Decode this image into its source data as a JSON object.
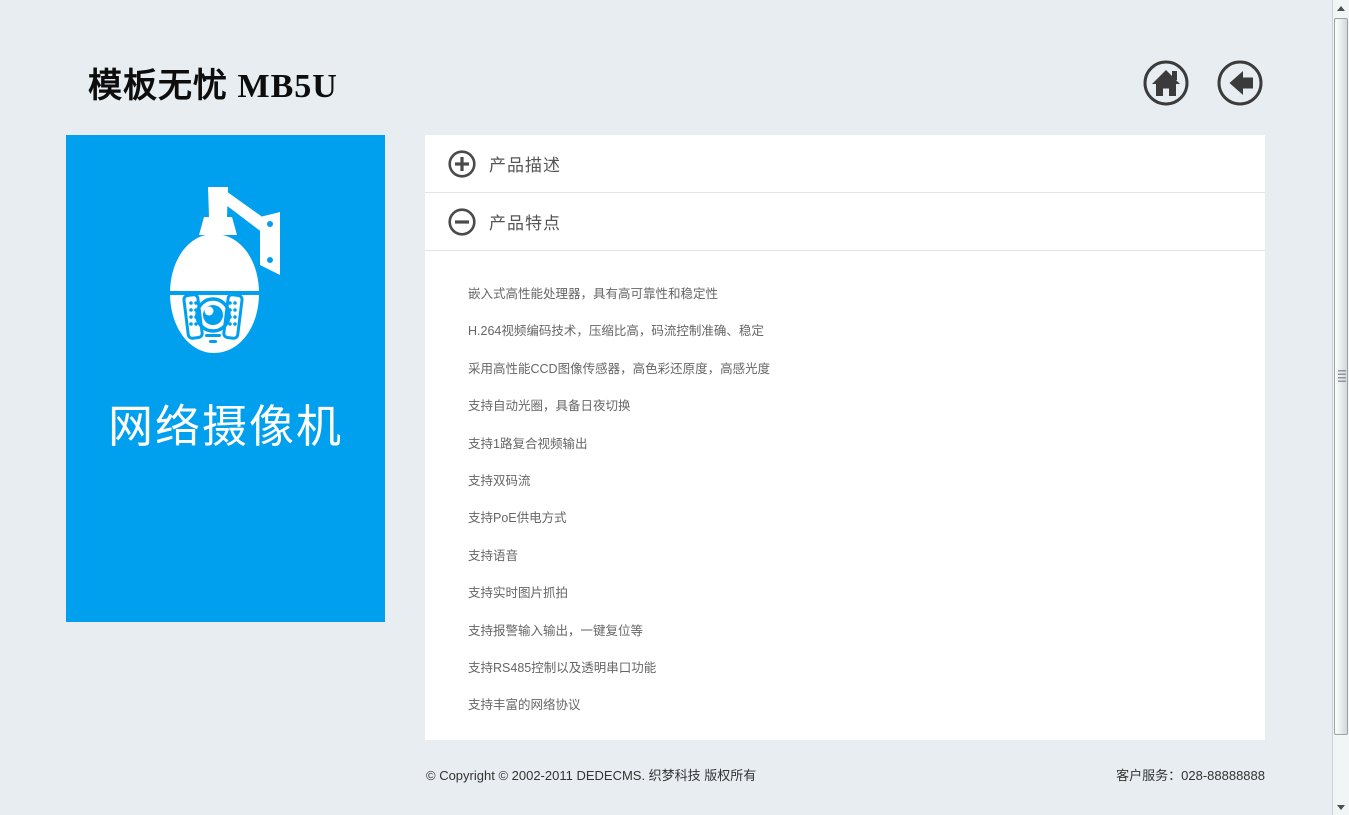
{
  "header": {
    "site_title": "模板无忧 MB5U"
  },
  "sidebar": {
    "product_name": "网络摄像机"
  },
  "accordion": {
    "sections": [
      {
        "label": "产品描述",
        "state": "collapsed"
      },
      {
        "label": "产品特点",
        "state": "expanded"
      }
    ]
  },
  "features": [
    "嵌入式高性能处理器，具有高可靠性和稳定性",
    "H.264视频编码技术，压缩比高，码流控制准确、稳定",
    "采用高性能CCD图像传感器，高色彩还原度，高感光度",
    "支持自动光圈，具备日夜切换",
    "支持1路复合视频输出",
    "支持双码流",
    "支持PoE供电方式",
    "支持语音",
    "支持实时图片抓拍",
    "支持报警输入输出，一键复位等",
    "支持RS485控制以及透明串口功能",
    "支持丰富的网络协议"
  ],
  "footer": {
    "copyright": "© Copyright © 2002-2011 DEDECMS. 织梦科技 版权所有",
    "customer_service": "客户服务：028-88888888"
  },
  "colors": {
    "accent_blue": "#01a0ef",
    "page_background": "#e7edf0",
    "panel_background": "#ffffff",
    "icon_dark": "#3b3b3b"
  }
}
